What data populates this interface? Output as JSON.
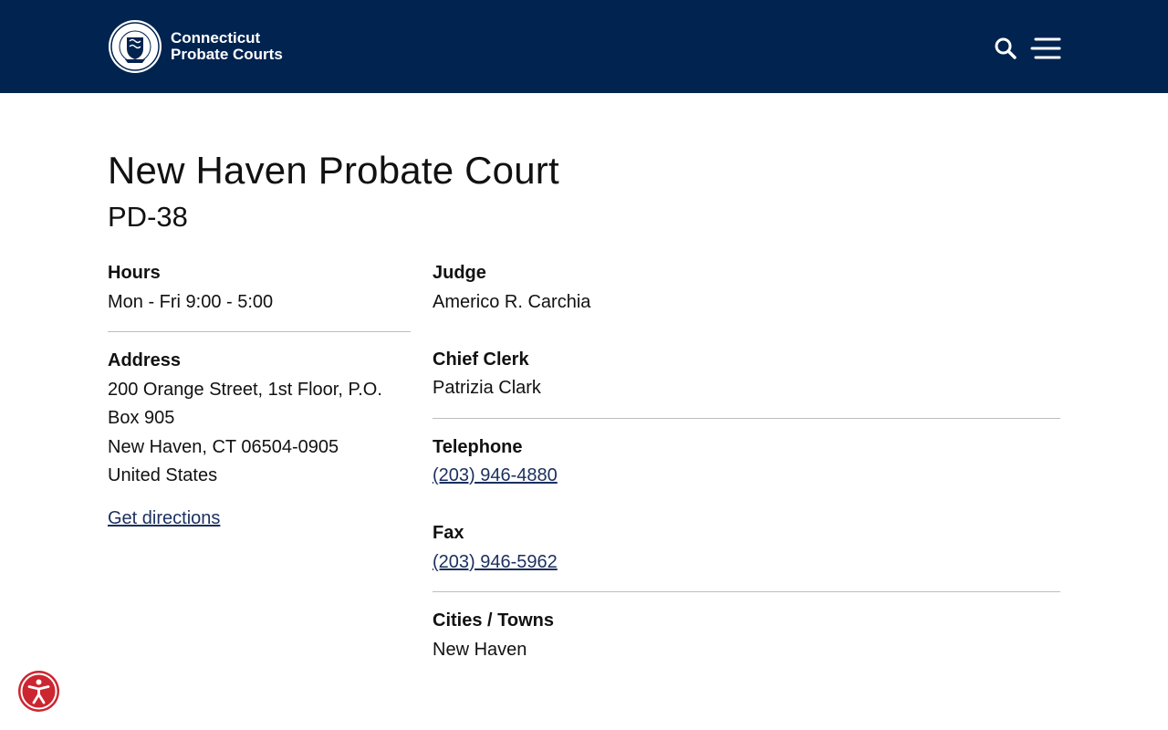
{
  "header": {
    "brand_line1": "Connecticut",
    "brand_line2": "Probate Courts",
    "logo_icon": "ct-seal-icon",
    "search_icon": "search-icon",
    "menu_icon": "hamburger-menu-icon",
    "background": "#00234f"
  },
  "page": {
    "title": "New Haven Probate Court",
    "code": "PD-38"
  },
  "left": {
    "hours_label": "Hours",
    "hours_value": "Mon - Fri 9:00 - 5:00",
    "address_label": "Address",
    "address_line1": "200 Orange Street, 1st Floor, P.O.",
    "address_line2": "Box 905",
    "address_line3": "New Haven, CT 06504-0905",
    "address_line4": "United States",
    "directions_link": "Get directions"
  },
  "right": {
    "judge_label": "Judge",
    "judge_value": "Americo R. Carchia",
    "clerk_label": "Chief Clerk",
    "clerk_value": "Patrizia Clark",
    "telephone_label": "Telephone",
    "telephone_value": "(203) 946-4880",
    "fax_label": "Fax",
    "fax_value": "(203) 946-5962",
    "towns_label": "Cities / Towns",
    "towns_value": "New Haven"
  },
  "accessibility": {
    "icon": "accessibility-icon",
    "color": "#cc2630"
  },
  "colors": {
    "link": "#1b2f5e",
    "divider": "#bdbdbd"
  }
}
